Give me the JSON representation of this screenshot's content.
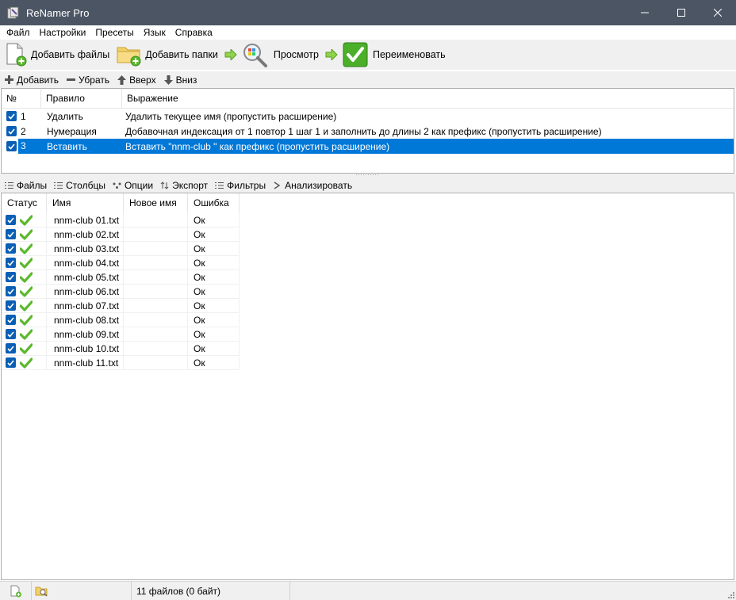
{
  "window": {
    "title": "ReNamer Pro"
  },
  "menu": [
    "Файл",
    "Настройки",
    "Пресеты",
    "Язык",
    "Справка"
  ],
  "toolbar": {
    "add_files": "Добавить файлы",
    "add_folders": "Добавить папки",
    "preview": "Просмотр",
    "rename": "Переименовать"
  },
  "rules_toolbar": {
    "add": "Добавить",
    "remove": "Убрать",
    "up": "Вверх",
    "down": "Вниз"
  },
  "rules": {
    "columns": [
      "№",
      "Правило",
      "Выражение"
    ],
    "rows": [
      {
        "num": "1",
        "rule": "Удалить",
        "expr": "Удалить текущее имя (пропустить расширение)",
        "checked": true
      },
      {
        "num": "2",
        "rule": "Нумерация",
        "expr": "Добавочная индексация от 1 повтор 1 шаг 1 и заполнить до длины 2 как префикс (пропустить расширение)",
        "checked": true
      },
      {
        "num": "3",
        "rule": "Вставить",
        "expr": "Вставить \"nnm-club \" как префикс (пропустить расширение)",
        "checked": true,
        "selected": true
      }
    ]
  },
  "files_toolbar": {
    "files": "Файлы",
    "columns": "Столбцы",
    "options": "Опции",
    "export": "Экспорт",
    "filters": "Фильтры",
    "analyze": "Анализировать"
  },
  "files": {
    "columns": [
      "Статус",
      "Имя",
      "Новое имя",
      "Ошибка"
    ],
    "rows": [
      {
        "name": "nnm-club 01.txt",
        "new_name": "",
        "error": "Ок"
      },
      {
        "name": "nnm-club 02.txt",
        "new_name": "",
        "error": "Ок"
      },
      {
        "name": "nnm-club 03.txt",
        "new_name": "",
        "error": "Ок"
      },
      {
        "name": "nnm-club 04.txt",
        "new_name": "",
        "error": "Ок"
      },
      {
        "name": "nnm-club 05.txt",
        "new_name": "",
        "error": "Ок"
      },
      {
        "name": "nnm-club 06.txt",
        "new_name": "",
        "error": "Ок"
      },
      {
        "name": "nnm-club 07.txt",
        "new_name": "",
        "error": "Ок"
      },
      {
        "name": "nnm-club 08.txt",
        "new_name": "",
        "error": "Ок"
      },
      {
        "name": "nnm-club 09.txt",
        "new_name": "",
        "error": "Ок"
      },
      {
        "name": "nnm-club 10.txt",
        "new_name": "",
        "error": "Ок"
      },
      {
        "name": "nnm-club 11.txt",
        "new_name": "",
        "error": "Ок"
      }
    ]
  },
  "statusbar": {
    "count": "11 файлов (0 байт)"
  },
  "colors": {
    "titlebar": "#4b5563",
    "selection": "#0078d7",
    "checkbox": "#0a5fb4",
    "ok_green": "#5cb82e"
  }
}
